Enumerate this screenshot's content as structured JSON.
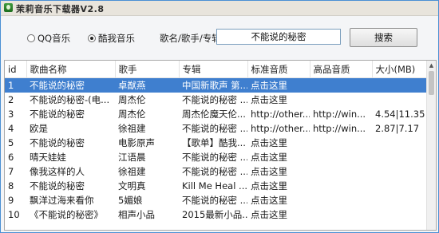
{
  "window": {
    "title": "茉莉音乐下载器V2.8"
  },
  "source": {
    "options": [
      {
        "label": "QQ音乐",
        "selected": false
      },
      {
        "label": "酷我音乐",
        "selected": true
      }
    ]
  },
  "search": {
    "label": "歌名/歌手/专辑:",
    "value": "不能说的秘密",
    "button_label": "搜索"
  },
  "table": {
    "columns": [
      "id",
      "歌曲名称",
      "歌手",
      "专辑",
      "标准音质",
      "高品音质",
      "大小(MB)"
    ],
    "selected_index": 0,
    "rows": [
      [
        "1",
        "不能说的秘密",
        "卓猷燕",
        "中国新歌声 第...",
        "点击这里",
        "",
        ""
      ],
      [
        "2",
        "不能说的秘密-(电...",
        "周杰伦",
        "不能说的秘密 ...",
        "点击这里",
        "",
        ""
      ],
      [
        "3",
        "不能说的秘密",
        "周杰伦",
        "周杰伦魔天伦...",
        "http://other...",
        "http://win...",
        "4.54|11.35"
      ],
      [
        "4",
        "欧是",
        "徐祖建",
        "不能说的秘密 ...",
        "http://other...",
        "http://win...",
        "2.87|7.17"
      ],
      [
        "5",
        "不能说的秘密",
        "电影原声",
        "【歌单】酷我...",
        "点击这里",
        "",
        ""
      ],
      [
        "6",
        "晴天娃娃",
        "江语晨",
        "不能说的秘密 ...",
        "点击这里",
        "",
        ""
      ],
      [
        "7",
        "像我这样的人",
        "徐祖建",
        "不能说的秘密 ...",
        "点击这里",
        "",
        ""
      ],
      [
        "8",
        "不能说的秘密",
        "文明真",
        "Kill Me Heal ...",
        "点击这里",
        "",
        ""
      ],
      [
        "9",
        "飘洋过海来看你",
        "5媚娘",
        "不能说的秘密 ...",
        "点击这里",
        "",
        ""
      ],
      [
        "10",
        "《不能说的秘密》",
        "相声小品",
        "2015最新小品...",
        "点击这里",
        "",
        ""
      ]
    ]
  }
}
